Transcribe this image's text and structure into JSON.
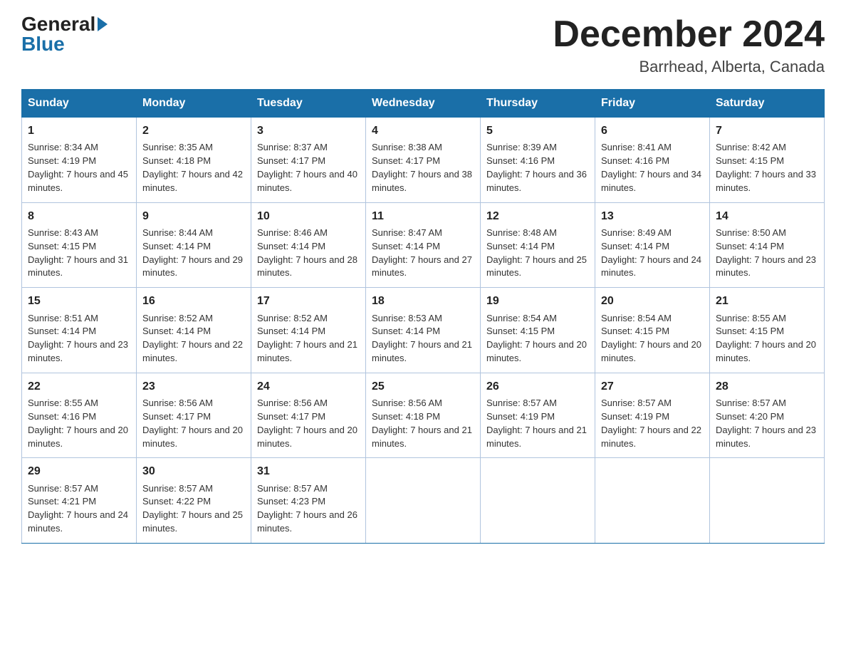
{
  "header": {
    "logo_general": "General",
    "logo_blue": "Blue",
    "month_title": "December 2024",
    "location": "Barrhead, Alberta, Canada"
  },
  "days_of_week": [
    "Sunday",
    "Monday",
    "Tuesday",
    "Wednesday",
    "Thursday",
    "Friday",
    "Saturday"
  ],
  "weeks": [
    [
      {
        "day": "1",
        "sunrise": "8:34 AM",
        "sunset": "4:19 PM",
        "daylight": "7 hours and 45 minutes."
      },
      {
        "day": "2",
        "sunrise": "8:35 AM",
        "sunset": "4:18 PM",
        "daylight": "7 hours and 42 minutes."
      },
      {
        "day": "3",
        "sunrise": "8:37 AM",
        "sunset": "4:17 PM",
        "daylight": "7 hours and 40 minutes."
      },
      {
        "day": "4",
        "sunrise": "8:38 AM",
        "sunset": "4:17 PM",
        "daylight": "7 hours and 38 minutes."
      },
      {
        "day": "5",
        "sunrise": "8:39 AM",
        "sunset": "4:16 PM",
        "daylight": "7 hours and 36 minutes."
      },
      {
        "day": "6",
        "sunrise": "8:41 AM",
        "sunset": "4:16 PM",
        "daylight": "7 hours and 34 minutes."
      },
      {
        "day": "7",
        "sunrise": "8:42 AM",
        "sunset": "4:15 PM",
        "daylight": "7 hours and 33 minutes."
      }
    ],
    [
      {
        "day": "8",
        "sunrise": "8:43 AM",
        "sunset": "4:15 PM",
        "daylight": "7 hours and 31 minutes."
      },
      {
        "day": "9",
        "sunrise": "8:44 AM",
        "sunset": "4:14 PM",
        "daylight": "7 hours and 29 minutes."
      },
      {
        "day": "10",
        "sunrise": "8:46 AM",
        "sunset": "4:14 PM",
        "daylight": "7 hours and 28 minutes."
      },
      {
        "day": "11",
        "sunrise": "8:47 AM",
        "sunset": "4:14 PM",
        "daylight": "7 hours and 27 minutes."
      },
      {
        "day": "12",
        "sunrise": "8:48 AM",
        "sunset": "4:14 PM",
        "daylight": "7 hours and 25 minutes."
      },
      {
        "day": "13",
        "sunrise": "8:49 AM",
        "sunset": "4:14 PM",
        "daylight": "7 hours and 24 minutes."
      },
      {
        "day": "14",
        "sunrise": "8:50 AM",
        "sunset": "4:14 PM",
        "daylight": "7 hours and 23 minutes."
      }
    ],
    [
      {
        "day": "15",
        "sunrise": "8:51 AM",
        "sunset": "4:14 PM",
        "daylight": "7 hours and 23 minutes."
      },
      {
        "day": "16",
        "sunrise": "8:52 AM",
        "sunset": "4:14 PM",
        "daylight": "7 hours and 22 minutes."
      },
      {
        "day": "17",
        "sunrise": "8:52 AM",
        "sunset": "4:14 PM",
        "daylight": "7 hours and 21 minutes."
      },
      {
        "day": "18",
        "sunrise": "8:53 AM",
        "sunset": "4:14 PM",
        "daylight": "7 hours and 21 minutes."
      },
      {
        "day": "19",
        "sunrise": "8:54 AM",
        "sunset": "4:15 PM",
        "daylight": "7 hours and 20 minutes."
      },
      {
        "day": "20",
        "sunrise": "8:54 AM",
        "sunset": "4:15 PM",
        "daylight": "7 hours and 20 minutes."
      },
      {
        "day": "21",
        "sunrise": "8:55 AM",
        "sunset": "4:15 PM",
        "daylight": "7 hours and 20 minutes."
      }
    ],
    [
      {
        "day": "22",
        "sunrise": "8:55 AM",
        "sunset": "4:16 PM",
        "daylight": "7 hours and 20 minutes."
      },
      {
        "day": "23",
        "sunrise": "8:56 AM",
        "sunset": "4:17 PM",
        "daylight": "7 hours and 20 minutes."
      },
      {
        "day": "24",
        "sunrise": "8:56 AM",
        "sunset": "4:17 PM",
        "daylight": "7 hours and 20 minutes."
      },
      {
        "day": "25",
        "sunrise": "8:56 AM",
        "sunset": "4:18 PM",
        "daylight": "7 hours and 21 minutes."
      },
      {
        "day": "26",
        "sunrise": "8:57 AM",
        "sunset": "4:19 PM",
        "daylight": "7 hours and 21 minutes."
      },
      {
        "day": "27",
        "sunrise": "8:57 AM",
        "sunset": "4:19 PM",
        "daylight": "7 hours and 22 minutes."
      },
      {
        "day": "28",
        "sunrise": "8:57 AM",
        "sunset": "4:20 PM",
        "daylight": "7 hours and 23 minutes."
      }
    ],
    [
      {
        "day": "29",
        "sunrise": "8:57 AM",
        "sunset": "4:21 PM",
        "daylight": "7 hours and 24 minutes."
      },
      {
        "day": "30",
        "sunrise": "8:57 AM",
        "sunset": "4:22 PM",
        "daylight": "7 hours and 25 minutes."
      },
      {
        "day": "31",
        "sunrise": "8:57 AM",
        "sunset": "4:23 PM",
        "daylight": "7 hours and 26 minutes."
      },
      null,
      null,
      null,
      null
    ]
  ]
}
